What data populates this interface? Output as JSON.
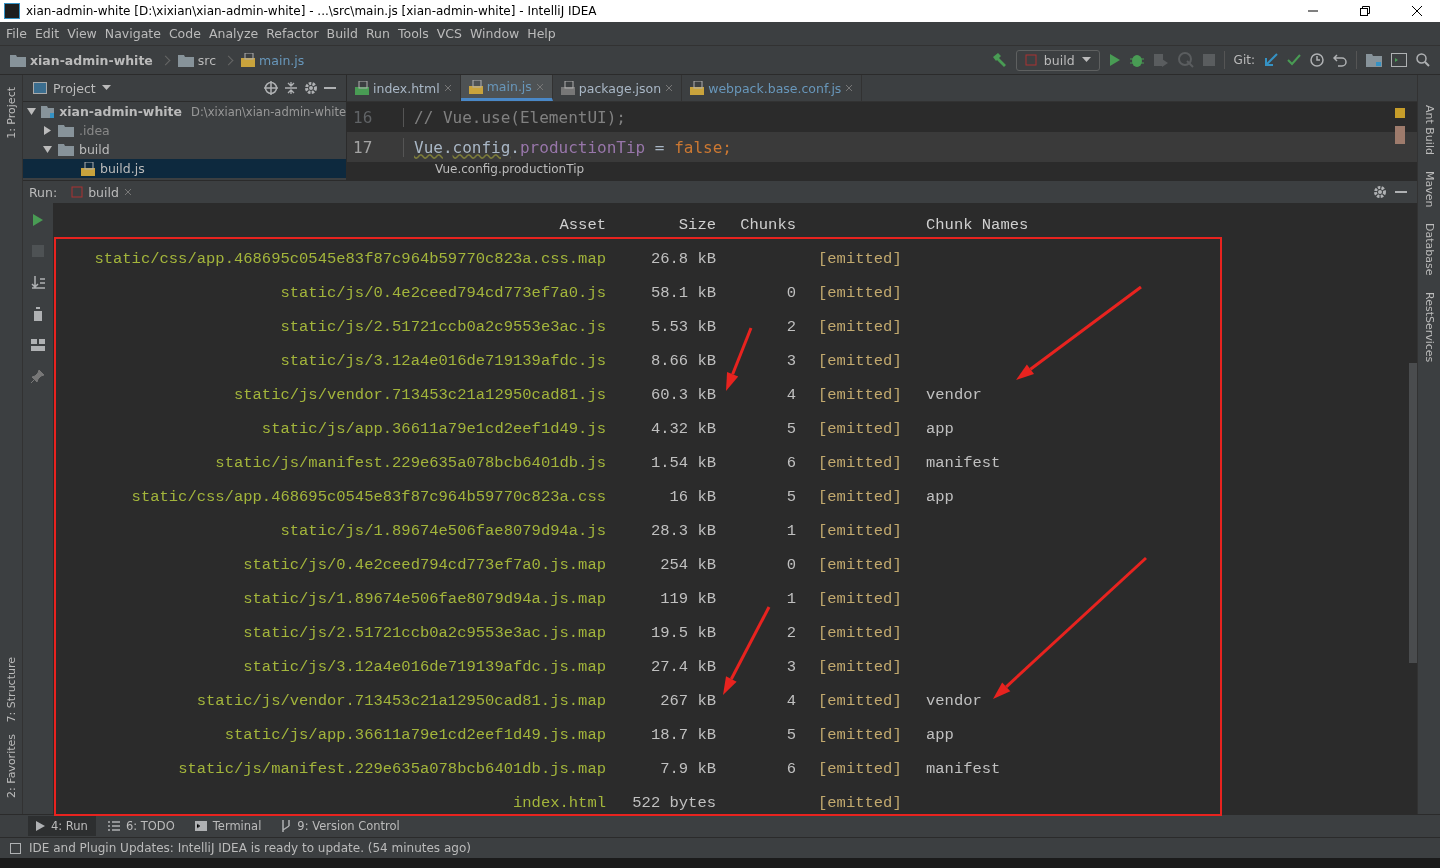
{
  "window": {
    "title": "xian-admin-white [D:\\xixian\\xian-admin-white] - ...\\src\\main.js [xian-admin-white] - IntelliJ IDEA"
  },
  "menu": [
    "File",
    "Edit",
    "View",
    "Navigate",
    "Code",
    "Analyze",
    "Refactor",
    "Build",
    "Run",
    "Tools",
    "VCS",
    "Window",
    "Help"
  ],
  "breadcrumbs": [
    {
      "label": "xian-admin-white",
      "kind": "project"
    },
    {
      "label": "src",
      "kind": "folder"
    },
    {
      "label": "main.js",
      "kind": "file"
    }
  ],
  "toolbar": {
    "run_config": "build",
    "git_label": "Git:"
  },
  "left_tool_windows": {
    "top": [
      "1: Project"
    ],
    "bottom": [
      "7: Structure",
      "2: Favorites"
    ]
  },
  "right_tool_windows": [
    "Ant Build",
    "Maven",
    "Database",
    "RestServices"
  ],
  "project_panel": {
    "title": "Project",
    "tree": [
      {
        "label": "xian-admin-white",
        "path": "D:\\xixian\\xian-admin-white",
        "kind": "project",
        "expanded": true,
        "selected": false,
        "children": [
          {
            "label": ".idea",
            "kind": "folder",
            "expanded": false,
            "selected": false
          },
          {
            "label": "build",
            "kind": "folder",
            "expanded": true,
            "selected": false,
            "children": [
              {
                "label": "build.js",
                "kind": "file",
                "selected": true
              }
            ]
          }
        ]
      }
    ]
  },
  "editor_tabs": [
    {
      "label": "index.html",
      "kind": "html",
      "selected": false
    },
    {
      "label": "main.js",
      "kind": "js",
      "selected": true
    },
    {
      "label": "package.json",
      "kind": "json",
      "selected": false
    },
    {
      "label": "webpack.base.conf.js",
      "kind": "js",
      "selected": false
    }
  ],
  "code_lines": [
    {
      "number": "16",
      "current": false,
      "tokens": [
        {
          "text": "// Vue.use(ElementUI);",
          "kind": "comment"
        }
      ]
    },
    {
      "number": "17",
      "current": true,
      "tokens": [
        {
          "text": "Vue",
          "kind": "warn"
        },
        {
          "text": ".",
          "kind": "plain"
        },
        {
          "text": "config",
          "kind": "warn"
        },
        {
          "text": ".",
          "kind": "plain"
        },
        {
          "text": "productionTip",
          "kind": "field"
        },
        {
          "text": " = ",
          "kind": "plain"
        },
        {
          "text": "false",
          "kind": "keyword"
        },
        {
          "text": ";",
          "kind": "keyword"
        }
      ]
    }
  ],
  "tooltip": "Vue.config.productionTip",
  "run_panel": {
    "label": "Run:",
    "tab": "build",
    "columns": [
      "Asset",
      "Size",
      "Chunks",
      "",
      "Chunk Names"
    ],
    "rows": [
      {
        "asset": "static/css/app.468695c0545e83f87c964b59770c823a.css.map",
        "size": "26.8 kB",
        "chunks": "",
        "status": "[emitted]",
        "names": ""
      },
      {
        "asset": "static/js/0.4e2ceed794cd773ef7a0.js",
        "size": "58.1 kB",
        "chunks": "0",
        "status": "[emitted]",
        "names": ""
      },
      {
        "asset": "static/js/2.51721ccb0a2c9553e3ac.js",
        "size": "5.53 kB",
        "chunks": "2",
        "status": "[emitted]",
        "names": ""
      },
      {
        "asset": "static/js/3.12a4e016de719139afdc.js",
        "size": "8.66 kB",
        "chunks": "3",
        "status": "[emitted]",
        "names": ""
      },
      {
        "asset": "static/js/vendor.713453c21a12950cad81.js",
        "size": "60.3 kB",
        "chunks": "4",
        "status": "[emitted]",
        "names": "vendor"
      },
      {
        "asset": "static/js/app.36611a79e1cd2eef1d49.js",
        "size": "4.32 kB",
        "chunks": "5",
        "status": "[emitted]",
        "names": "app"
      },
      {
        "asset": "static/js/manifest.229e635a078bcb6401db.js",
        "size": "1.54 kB",
        "chunks": "6",
        "status": "[emitted]",
        "names": "manifest"
      },
      {
        "asset": "static/css/app.468695c0545e83f87c964b59770c823a.css",
        "size": "16 kB",
        "chunks": "5",
        "status": "[emitted]",
        "names": "app"
      },
      {
        "asset": "static/js/1.89674e506fae8079d94a.js",
        "size": "28.3 kB",
        "chunks": "1",
        "status": "[emitted]",
        "names": ""
      },
      {
        "asset": "static/js/0.4e2ceed794cd773ef7a0.js.map",
        "size": "254 kB",
        "chunks": "0",
        "status": "[emitted]",
        "names": ""
      },
      {
        "asset": "static/js/1.89674e506fae8079d94a.js.map",
        "size": "119 kB",
        "chunks": "1",
        "status": "[emitted]",
        "names": ""
      },
      {
        "asset": "static/js/2.51721ccb0a2c9553e3ac.js.map",
        "size": "19.5 kB",
        "chunks": "2",
        "status": "[emitted]",
        "names": ""
      },
      {
        "asset": "static/js/3.12a4e016de719139afdc.js.map",
        "size": "27.4 kB",
        "chunks": "3",
        "status": "[emitted]",
        "names": ""
      },
      {
        "asset": "static/js/vendor.713453c21a12950cad81.js.map",
        "size": "267 kB",
        "chunks": "4",
        "status": "[emitted]",
        "names": "vendor"
      },
      {
        "asset": "static/js/app.36611a79e1cd2eef1d49.js.map",
        "size": "18.7 kB",
        "chunks": "5",
        "status": "[emitted]",
        "names": "app"
      },
      {
        "asset": "static/js/manifest.229e635a078bcb6401db.js.map",
        "size": "7.9 kB",
        "chunks": "6",
        "status": "[emitted]",
        "names": "manifest"
      },
      {
        "asset": "index.html",
        "size": "522 bytes",
        "chunks": "",
        "status": "[emitted]",
        "names": ""
      }
    ]
  },
  "bottom_tabs": [
    {
      "label": "4: Run",
      "kind": "run",
      "selected": true
    },
    {
      "label": "6: TODO",
      "kind": "todo",
      "selected": false
    },
    {
      "label": "Terminal",
      "kind": "terminal",
      "selected": false
    },
    {
      "label": "9: Version Control",
      "kind": "vcs",
      "selected": false
    }
  ],
  "status_bar": {
    "message": "IDE and Plugin Updates: IntelliJ IDEA is ready to update. (54 minutes ago)"
  }
}
